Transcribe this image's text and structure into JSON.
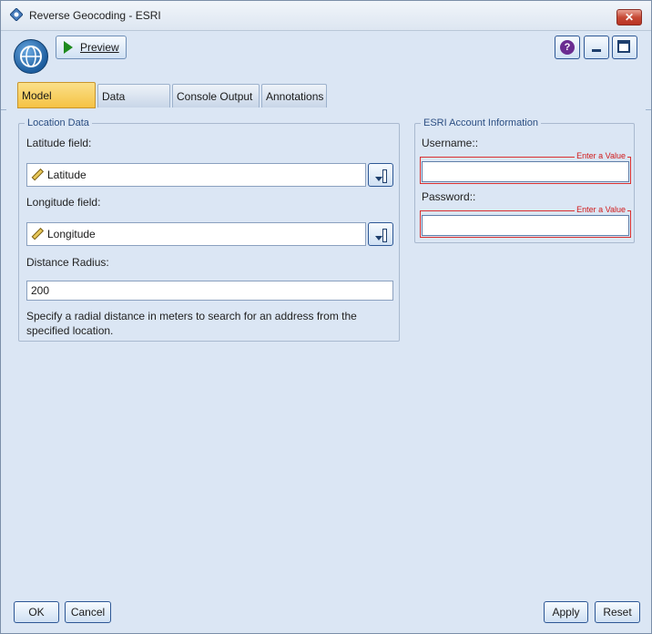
{
  "window": {
    "title": "Reverse Geocoding - ESRI",
    "close_glyph": "✕"
  },
  "toolbar": {
    "preview_label": "Preview",
    "help_glyph": "?",
    "icons": [
      "app-globe-icon",
      "play-icon",
      "help-icon",
      "minimize-icon",
      "maximize-icon"
    ]
  },
  "tabs": [
    {
      "label": "Model Options",
      "active": true
    },
    {
      "label": "Data Options",
      "active": false
    },
    {
      "label": "Console Output",
      "active": false
    },
    {
      "label": "Annotations",
      "active": false
    }
  ],
  "location": {
    "group_label": "Location Data",
    "latitude_label": "Latitude field:",
    "latitude_value": "Latitude",
    "longitude_label": "Longitude field:",
    "longitude_value": "Longitude",
    "radius_label": "Distance Radius:",
    "radius_value": "200",
    "help_line1": "Specify a radial distance in meters to search for an address from the",
    "help_line2": "specified location."
  },
  "account": {
    "group_label": "ESRI Account Information",
    "username_label": "Username::",
    "password_label": "Password::",
    "required_hint": "Enter a Value",
    "username_value": "",
    "password_value": ""
  },
  "buttons": {
    "ok": "OK",
    "cancel": "Cancel",
    "apply": "Apply",
    "reset": "Reset"
  },
  "colors": {
    "panel_bg": "#dbe6f4",
    "active_tab": "#f5c243",
    "required_border": "#d93030"
  }
}
